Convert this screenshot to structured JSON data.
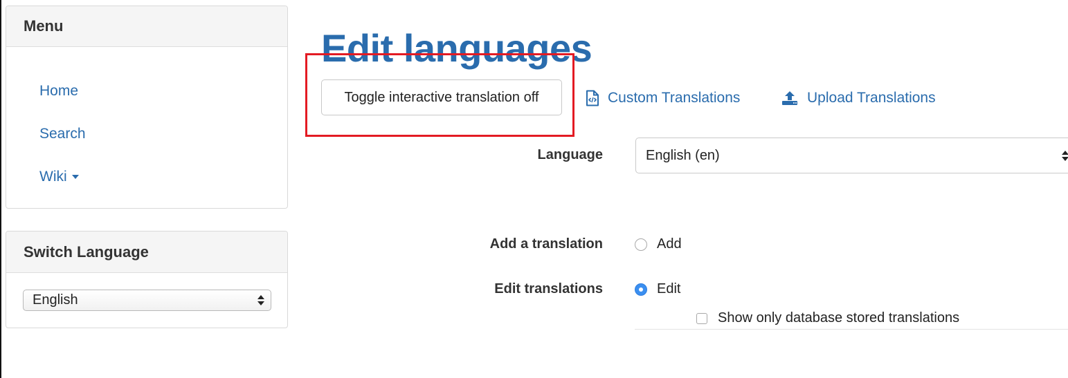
{
  "sidebar": {
    "menu": {
      "title": "Menu",
      "items": [
        {
          "label": "Home"
        },
        {
          "label": "Search"
        },
        {
          "label": "Wiki"
        }
      ]
    },
    "switch_language": {
      "title": "Switch Language",
      "selected": "English"
    }
  },
  "main": {
    "title": "Edit languages",
    "toggle_button_label": "Toggle interactive translation off",
    "links": {
      "custom_translations": "Custom Translations",
      "upload_translations": "Upload Translations"
    },
    "form": {
      "language_label": "Language",
      "language_selected": "English (en)",
      "add_label": "Add a translation",
      "add_option": "Add",
      "add_checked": false,
      "edit_label": "Edit translations",
      "edit_option": "Edit",
      "edit_checked": true,
      "db_only_label": "Show only database stored translations",
      "db_only_checked": false
    }
  },
  "colors": {
    "link": "#2a6cad",
    "highlight": "#e31b23",
    "radio_checked": "#3b8ff0"
  },
  "icons": {
    "custom_translations": "code-file-icon",
    "upload_translations": "upload-icon",
    "wiki_dropdown": "caret-down-icon"
  }
}
